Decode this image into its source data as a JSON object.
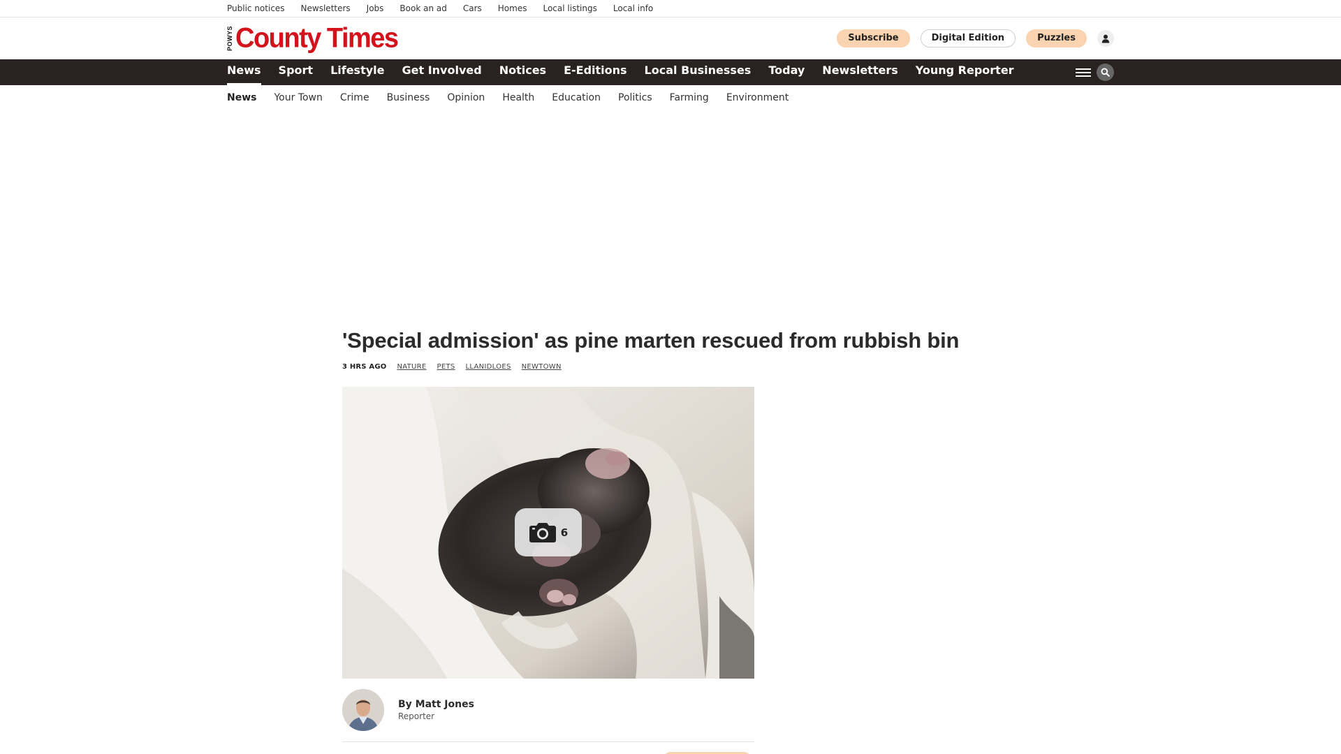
{
  "topbar": {
    "links": [
      "Public notices",
      "Newsletters",
      "Jobs",
      "Book an ad",
      "Cars",
      "Homes",
      "Local listings",
      "Local info"
    ]
  },
  "brand": {
    "logo_small": "POWYS",
    "logo_main": "County Times",
    "logo_color": "#d4121c"
  },
  "header_actions": {
    "subscribe": "Subscribe",
    "digital_edition": "Digital Edition",
    "puzzles": "Puzzles",
    "accent_color": "#fad4b0"
  },
  "main_nav": {
    "background": "#2a2220",
    "items": [
      "News",
      "Sport",
      "Lifestyle",
      "Get Involved",
      "Notices",
      "E-Editions",
      "Local Businesses",
      "Today",
      "Newsletters",
      "Young Reporter"
    ],
    "active": "News"
  },
  "sub_nav": {
    "items": [
      "News",
      "Your Town",
      "Crime",
      "Business",
      "Opinion",
      "Health",
      "Education",
      "Politics",
      "Farming",
      "Environment"
    ],
    "active": "News"
  },
  "article": {
    "headline": "'Special admission' as pine marten rescued from rubbish bin",
    "time": "3 HRS AGO",
    "tags": [
      "NATURE",
      "PETS",
      "LLANIDLOES",
      "NEWTOWN"
    ],
    "gallery_count": "6",
    "author_prefix": "By",
    "author_name": "Matt Jones",
    "author_role": "Reporter"
  }
}
